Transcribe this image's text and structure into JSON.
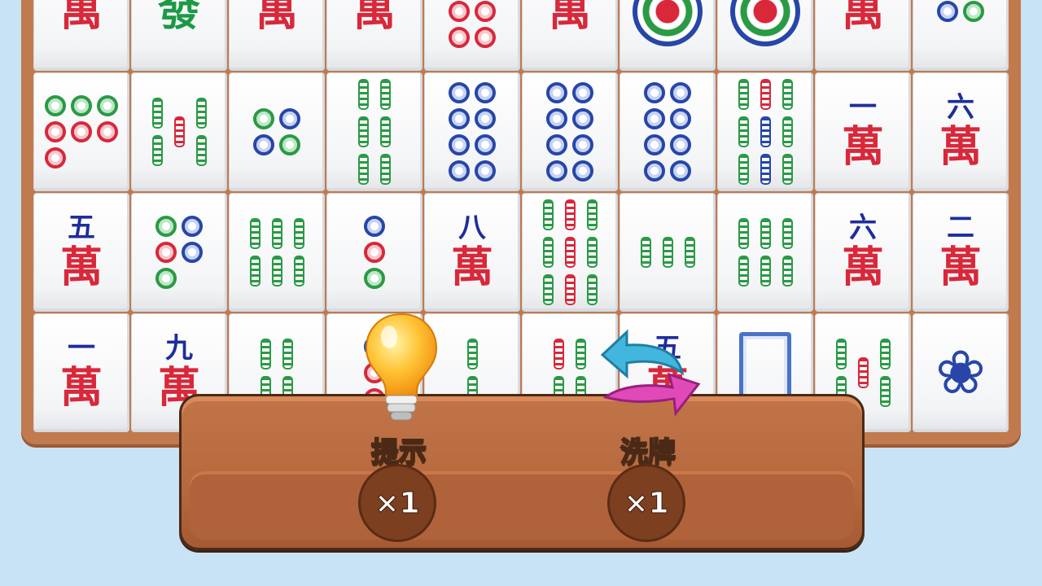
{
  "tiles": [
    [
      {
        "kind": "wan",
        "num": ""
      },
      {
        "kind": "dragon",
        "text": "發"
      },
      {
        "kind": "wan",
        "num": ""
      },
      {
        "kind": "wan",
        "num": ""
      },
      {
        "kind": "dots",
        "dots": [
          "g",
          "r",
          "r",
          "r",
          "r",
          "r"
        ],
        "cols": 2
      },
      {
        "kind": "wan",
        "num": ""
      },
      {
        "kind": "flower"
      },
      {
        "kind": "flower"
      },
      {
        "kind": "wan",
        "num": ""
      },
      {
        "kind": "dots",
        "dots": [
          "b",
          "g"
        ],
        "cols": 2
      }
    ],
    [
      {
        "kind": "dots",
        "dots": [
          "g",
          "g",
          "g",
          "r",
          "r",
          "r",
          "r"
        ],
        "cols": 3
      },
      {
        "kind": "sticks",
        "cols": [
          [
            "g",
            "g"
          ],
          [
            "r"
          ],
          [
            "g",
            "g"
          ]
        ]
      },
      {
        "kind": "dots",
        "dots": [
          "g",
          "b",
          "b",
          "g"
        ],
        "cols": 2
      },
      {
        "kind": "sticks",
        "cols": [
          [
            "g",
            "g",
            "g"
          ],
          [
            "g",
            "g",
            "g"
          ]
        ]
      },
      {
        "kind": "dots",
        "dots": [
          "b",
          "b",
          "b",
          "b",
          "b",
          "b",
          "b",
          "b"
        ],
        "cols": 2
      },
      {
        "kind": "dots",
        "dots": [
          "b",
          "b",
          "b",
          "b",
          "b",
          "b",
          "b",
          "b"
        ],
        "cols": 2
      },
      {
        "kind": "dots",
        "dots": [
          "b",
          "b",
          "b",
          "b",
          "b",
          "b",
          "b",
          "b"
        ],
        "cols": 2
      },
      {
        "kind": "sticks",
        "cols": [
          [
            "g",
            "g",
            "g"
          ],
          [
            "r",
            "b",
            "b"
          ],
          [
            "g",
            "g",
            "g"
          ]
        ]
      },
      {
        "kind": "wan",
        "num": "一"
      },
      {
        "kind": "wan",
        "num": "六"
      }
    ],
    [
      {
        "kind": "wan",
        "num": "五"
      },
      {
        "kind": "dots",
        "dots": [
          "g",
          "b",
          "r",
          "b",
          "g"
        ],
        "cols": 2
      },
      {
        "kind": "sticks",
        "cols": [
          [
            "g",
            "g"
          ],
          [
            "g",
            "g"
          ],
          [
            "g",
            "g"
          ]
        ]
      },
      {
        "kind": "dots",
        "dots": [
          "b",
          "r",
          "g"
        ],
        "cols": 1
      },
      {
        "kind": "wan",
        "num": "八"
      },
      {
        "kind": "sticks",
        "cols": [
          [
            "g",
            "g",
            "g"
          ],
          [
            "r",
            "r",
            "r"
          ],
          [
            "g",
            "g",
            "g"
          ]
        ]
      },
      {
        "kind": "sticks",
        "cols": [
          [
            "g"
          ],
          [
            "g"
          ],
          [
            "g"
          ]
        ]
      },
      {
        "kind": "sticks",
        "cols": [
          [
            "g",
            "g"
          ],
          [
            "g",
            "g"
          ],
          [
            "g",
            "g"
          ]
        ]
      },
      {
        "kind": "wan",
        "num": "六"
      },
      {
        "kind": "wan",
        "num": "二"
      }
    ],
    [
      {
        "kind": "wan",
        "num": "一"
      },
      {
        "kind": "wan",
        "num": "九"
      },
      {
        "kind": "sticks",
        "cols": [
          [
            "g",
            "g"
          ],
          [
            "g",
            "g"
          ]
        ]
      },
      {
        "kind": "dots",
        "dots": [
          "b",
          "r",
          "r"
        ],
        "cols": 1
      },
      {
        "kind": "sticks",
        "cols": [
          [
            "g",
            "g"
          ]
        ]
      },
      {
        "kind": "sticks",
        "cols": [
          [
            "r",
            "g"
          ],
          [
            "g",
            "g"
          ]
        ]
      },
      {
        "kind": "wan",
        "num": "五"
      },
      {
        "kind": "frame"
      },
      {
        "kind": "sticks",
        "cols": [
          [
            "g",
            "g"
          ],
          [
            "r"
          ],
          [
            "g",
            "g"
          ]
        ]
      },
      {
        "kind": "bird"
      }
    ]
  ],
  "wan_char": "萬",
  "toolbar": {
    "hint_label": "提示",
    "hint_count": "×1",
    "shuffle_label": "洗牌",
    "shuffle_count": "×1"
  },
  "colors": {
    "board": "#c07a4e",
    "tray": "#b86a3f",
    "background": "#c9e3f6"
  },
  "icons": {
    "hint": "lightbulb-icon",
    "shuffle": "shuffle-arrows-icon"
  }
}
